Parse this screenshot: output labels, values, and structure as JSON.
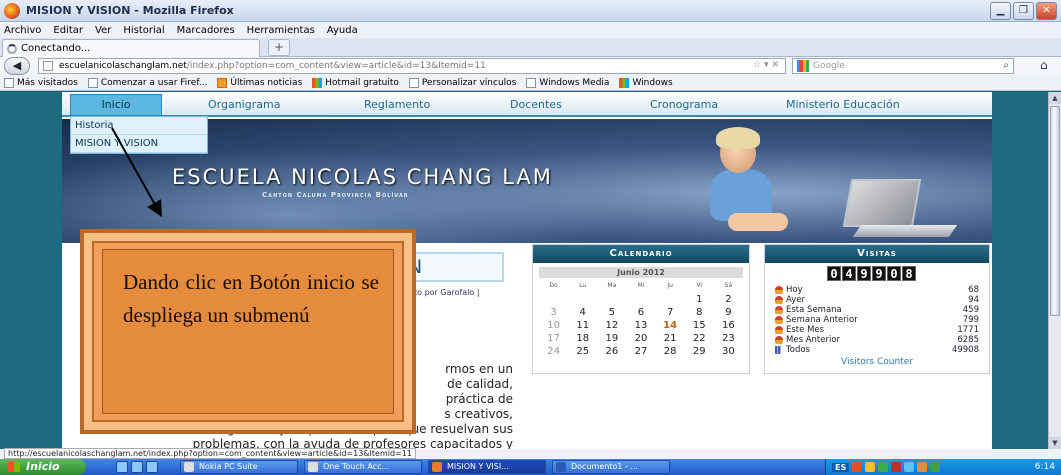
{
  "window": {
    "title": "MISION Y VISION - Mozilla Firefox"
  },
  "menubar": [
    "Archivo",
    "Editar",
    "Ver",
    "Historial",
    "Marcadores",
    "Herramientas",
    "Ayuda"
  ],
  "tab": {
    "label": "Conectando...",
    "new_tab": "+"
  },
  "navbar": {
    "url_domain": "escuelanicolaschanglam.net",
    "url_path": "/index.php?option=com_content&view=article&id=13&Itemid=11",
    "search_placeholder": "Google"
  },
  "bookmarks": [
    {
      "label": "Más visitados",
      "icon": "bookmark-icon"
    },
    {
      "label": "Comenzar a usar Firef...",
      "icon": "page-icon"
    },
    {
      "label": "Últimas noticias",
      "icon": "rss-icon"
    },
    {
      "label": "Hotmail gratuito",
      "icon": "msn-icon"
    },
    {
      "label": "Personalizar vínculos",
      "icon": "page-icon"
    },
    {
      "label": "Windows Media",
      "icon": "page-icon"
    },
    {
      "label": "Windows",
      "icon": "msn-icon"
    }
  ],
  "site": {
    "nav": [
      "Inicio",
      "Organigrama",
      "Reglamento",
      "Docentes",
      "Cronograma",
      "Ministerio Educación"
    ],
    "submenu": [
      "Historia",
      "MISION Y VISION"
    ],
    "school_name": "ESCUELA NICOLAS CHANG LAM",
    "school_sub": "Cantón Caluma Provincia Bolívar",
    "article_title_fragment": "N",
    "byline": "to por Garofalo |",
    "body_lines": [
      "rmos en un",
      "de calidad,",
      "práctica de",
      "s creativos,",
      "investigadores y responsables para que resuelvan sus",
      "problemas, con la ayuda de profesores capacitados y"
    ]
  },
  "calendar": {
    "title": "Calendario",
    "month": "Junio 2012",
    "day_names": [
      "Do",
      "Lu",
      "Ma",
      "Mi",
      "Ju",
      "Vi",
      "Sá"
    ],
    "weeks": [
      [
        "",
        "",
        "",
        "",
        "",
        "1",
        "2"
      ],
      [
        "3",
        "4",
        "5",
        "6",
        "7",
        "8",
        "9"
      ],
      [
        "10",
        "11",
        "12",
        "13",
        "14",
        "15",
        "16"
      ],
      [
        "17",
        "18",
        "19",
        "20",
        "21",
        "22",
        "23"
      ],
      [
        "24",
        "25",
        "26",
        "27",
        "28",
        "29",
        "30"
      ]
    ],
    "today": "14"
  },
  "visits": {
    "title": "Visitas",
    "counter_digits": [
      "0",
      "4",
      "9",
      "9",
      "0",
      "8"
    ],
    "stats": [
      {
        "label": "Hoy",
        "value": "68"
      },
      {
        "label": "Ayer",
        "value": "94"
      },
      {
        "label": "Esta Semana",
        "value": "459"
      },
      {
        "label": "Semana Anterior",
        "value": "799"
      },
      {
        "label": "Este Mes",
        "value": "1771"
      },
      {
        "label": "Mes Anterior",
        "value": "6285"
      },
      {
        "label": "Todos",
        "value": "49908"
      }
    ],
    "link": "Visitors Counter"
  },
  "callout": {
    "text": "Dando clic en Botón inicio se despliega un submenú"
  },
  "statusbar": "http://escuelanicolaschanglam.net/index.php?option=com_content&view=article&id=13&Itemid=11",
  "taskbar": {
    "start": "Inicio",
    "tasks": [
      "Nokia PC Suite",
      "One Touch Acc...",
      "MISION Y VISI...",
      "Documento1 - ..."
    ],
    "lang": "ES",
    "clock": "6:14"
  }
}
